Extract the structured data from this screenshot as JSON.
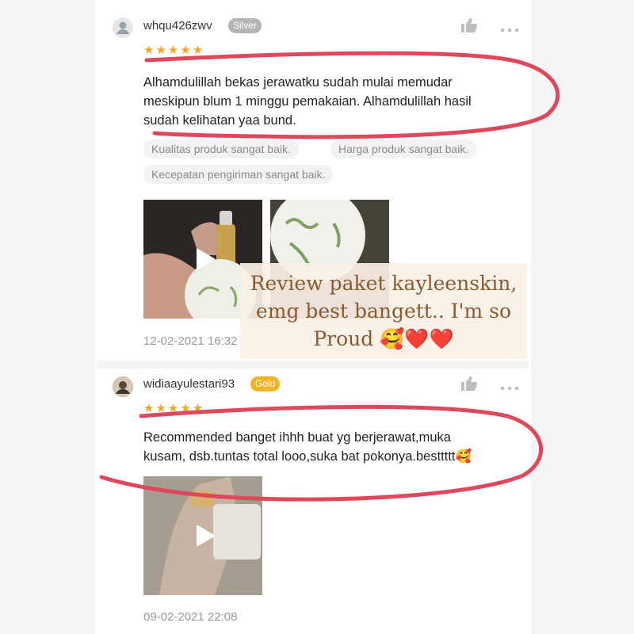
{
  "reviews": [
    {
      "username": "whqu426zwv",
      "badge": "Silver",
      "badge_color": "#b5b5b5",
      "rating": 5,
      "text_lines": [
        "Alhamdulillah bekas jerawatku sudah mulai memudar",
        "meskipun blum 1 minggu pemakaian. Alhamdulillah hasil",
        "sudah kelihatan yaa bund."
      ],
      "tags": [
        "Kualitas produk sangat baik.",
        "Harga produk sangat baik.",
        "Kecepatan pengiriman sangat baik."
      ],
      "date": "12-02-2021 16:32"
    },
    {
      "username": "widiaayulestari93",
      "badge": "Gold",
      "badge_color": "#f0b429",
      "rating": 5,
      "text_lines": [
        "Recommended banget ihhh buat yg berjerawat,muka",
        "kusam, dsb.tuntas total looo,suka bat pokonya.besttttt🥰"
      ],
      "date": "09-02-2021 22:08"
    }
  ],
  "overlay": {
    "lines": [
      "Review paket kayleenskin,",
      "emg best bangett.. I'm so",
      "Proud 🥰❤️❤️"
    ]
  },
  "icons": [
    "user-avatar-icon",
    "thumbs-up-icon",
    "more-icon",
    "star-icon",
    "play-icon"
  ],
  "colors": {
    "star": "#f5a623",
    "circle": "#e0475a",
    "overlay_text": "#8c5a2f"
  }
}
